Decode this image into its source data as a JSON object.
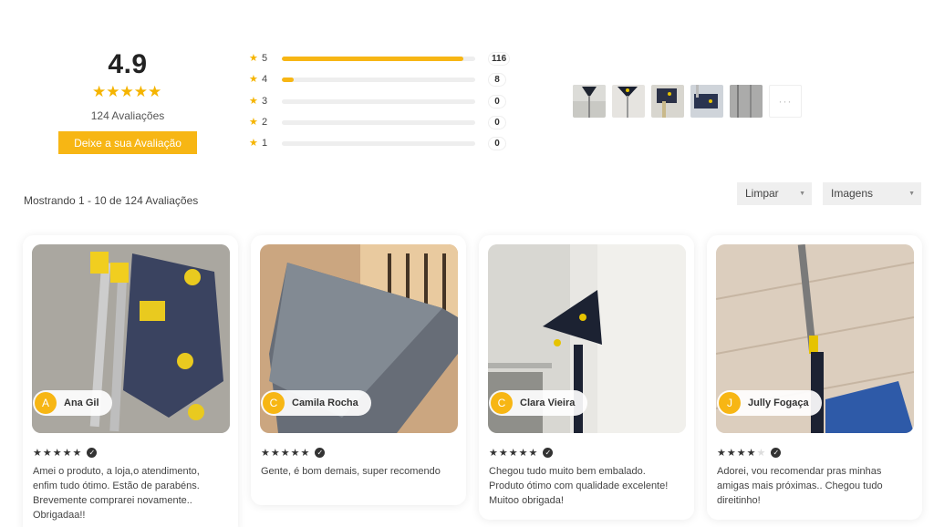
{
  "summary": {
    "score": "4.9",
    "stars": "★★★★★",
    "review_count": "124 Avaliações",
    "cta_label": "Deixe a sua Avaliação",
    "accent_color": "#f7b614"
  },
  "distribution": [
    {
      "label": "5",
      "count": "116",
      "fraction": 0.94
    },
    {
      "label": "4",
      "count": "8",
      "fraction": 0.06
    },
    {
      "label": "3",
      "count": "0",
      "fraction": 0
    },
    {
      "label": "2",
      "count": "0",
      "fraction": 0
    },
    {
      "label": "1",
      "count": "0",
      "fraction": 0
    }
  ],
  "gallery": {
    "more_label": "···"
  },
  "toolbar": {
    "showing": "Mostrando 1 - 10 de 124 Avaliações",
    "sort_value": "Limpar",
    "filter_value": "Imagens"
  },
  "reviews": [
    {
      "initial": "A",
      "author": "Ana Gil",
      "rating": 5,
      "text": "Amei o produto, a loja,o atendimento, enfim tudo ótimo. Estão de parabéns. Brevemente comprarei novamente.. Obrigadaa!!"
    },
    {
      "initial": "C",
      "author": "Camila Rocha",
      "rating": 5,
      "text": "Gente, é bom demais, super recomendo"
    },
    {
      "initial": "C",
      "author": "Clara Vieira",
      "rating": 5,
      "text": "Chegou tudo muito bem embalado. Produto ótimo com qualidade excelente! Muitoo obrigada!"
    },
    {
      "initial": "J",
      "author": "Jully Fogaça",
      "rating": 4,
      "text": "Adorei, vou recomendar pras minhas amigas mais próximas.. Chegou tudo direitinho!"
    }
  ]
}
